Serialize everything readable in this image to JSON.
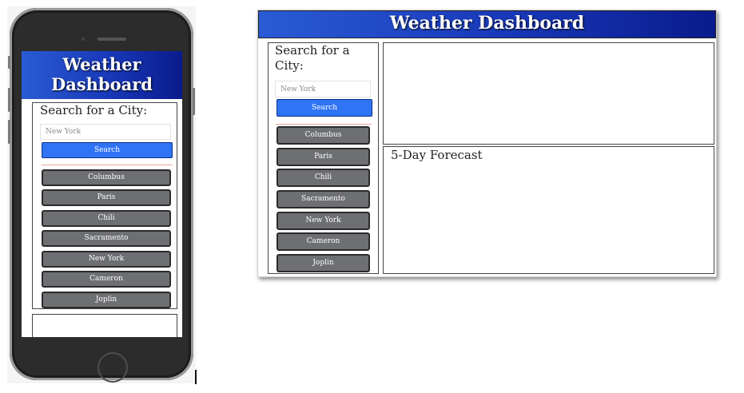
{
  "app": {
    "title": "Weather Dashboard",
    "title_line1": "Weather",
    "title_line2": "Dashboard"
  },
  "search": {
    "heading": "Search for a City:",
    "placeholder": "New York",
    "button_label": "Search"
  },
  "history": {
    "cities": [
      "Columbus",
      "Paris",
      "Chili",
      "Sacramento",
      "New York",
      "Cameron",
      "Joplin"
    ]
  },
  "forecast": {
    "heading": "5-Day Forecast"
  },
  "colors": {
    "header_gradient_start": "#2a5bd4",
    "header_gradient_end": "#0a1b8c",
    "search_button": "#2f74f5",
    "city_button": "#6d6f73"
  }
}
